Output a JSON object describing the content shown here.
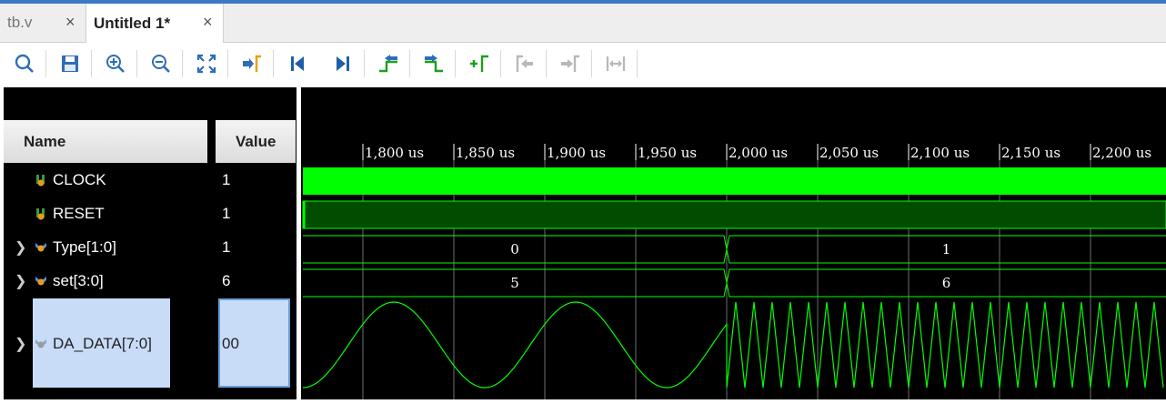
{
  "tabs": [
    {
      "label": "tb.v",
      "close": "×"
    },
    {
      "label": "Untitled 1*",
      "close": "×"
    }
  ],
  "toolbar": [
    {
      "name": "search-button",
      "icon": "magnifier-icon"
    },
    {
      "name": "save-button",
      "icon": "save-icon"
    },
    {
      "name": "zoom-in-button",
      "icon": "zoom-in-icon"
    },
    {
      "name": "zoom-out-button",
      "icon": "zoom-out-icon"
    },
    {
      "name": "zoom-fit-button",
      "icon": "zoom-fit-icon"
    },
    {
      "name": "go-to-cursor-button",
      "icon": "go-to-cursor-icon"
    },
    {
      "name": "go-to-time-zero-button",
      "icon": "go-to-start-icon"
    },
    {
      "name": "go-to-last-time-button",
      "icon": "go-to-end-icon"
    },
    {
      "name": "previous-transition-button",
      "icon": "previous-transition-icon"
    },
    {
      "name": "next-transition-button",
      "icon": "next-transition-icon"
    },
    {
      "name": "add-marker-button",
      "icon": "add-marker-icon"
    },
    {
      "name": "previous-marker-button",
      "icon": "previous-marker-icon"
    },
    {
      "name": "next-marker-button",
      "icon": "next-marker-icon"
    },
    {
      "name": "swap-cursors-button",
      "icon": "swap-cursors-icon"
    }
  ],
  "columns": {
    "name": "Name",
    "value": "Value"
  },
  "signals": [
    {
      "name": "CLOCK",
      "value": "1",
      "kind": "bit",
      "expandable": false
    },
    {
      "name": "RESET",
      "value": "1",
      "kind": "bit",
      "expandable": false
    },
    {
      "name": "Type[1:0]",
      "value": "1",
      "kind": "bus",
      "expandable": true
    },
    {
      "name": "set[3:0]",
      "value": "6",
      "kind": "bus",
      "expandable": true
    },
    {
      "name": "DA_DATA[7:0]",
      "value": "00",
      "kind": "analog",
      "expandable": true
    }
  ],
  "timeline": {
    "ticks": [
      "1,800 us",
      "1,850 us",
      "1,900 us",
      "1,950 us",
      "2,000 us",
      "2,050 us",
      "2,100 us",
      "2,150 us",
      "2,200 us"
    ],
    "transition_time": "2,000 us",
    "type_values": [
      "0",
      "1"
    ],
    "set_values": [
      "5",
      "6"
    ]
  },
  "colors": {
    "wave": "#00ff00",
    "reset_fill": "#004d00",
    "background": "#000000",
    "selection": "#c8dcf8"
  }
}
